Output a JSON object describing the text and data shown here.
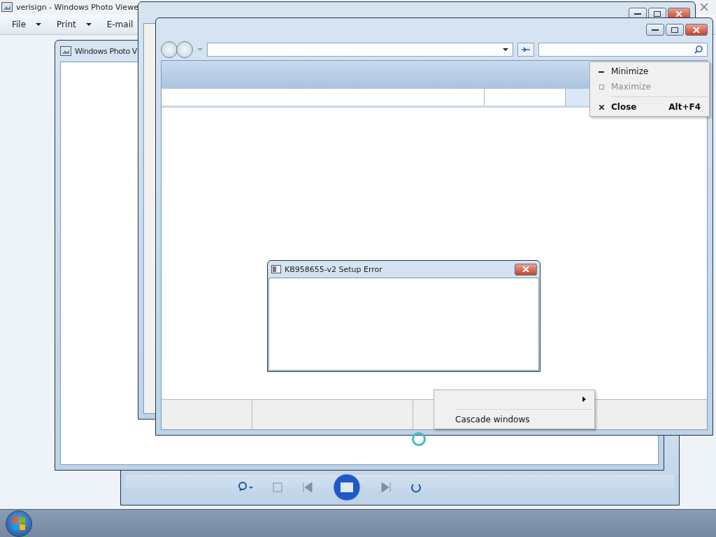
{
  "photo_viewer": {
    "title": "verisign - Windows Photo Viewe",
    "menu": [
      {
        "label": "File",
        "dropdown": true
      },
      {
        "label": "Print",
        "dropdown": true
      },
      {
        "label": "E-mail",
        "dropdown": false
      }
    ]
  },
  "inner_photo_viewer": {
    "title": "Windows Photo V"
  },
  "jump_menu": {
    "items": [
      {
        "label": "Cascade windows"
      }
    ]
  },
  "context_menu": {
    "items": [
      {
        "kind": "minimize",
        "label": "Minimize",
        "disabled": false
      },
      {
        "kind": "maximize",
        "label": "Maximize",
        "disabled": true
      },
      {
        "kind": "close",
        "label": "Close",
        "shortcut": "Alt+F4",
        "disabled": false
      }
    ]
  },
  "dialog": {
    "title": "KB958655-v2 Setup Error"
  }
}
